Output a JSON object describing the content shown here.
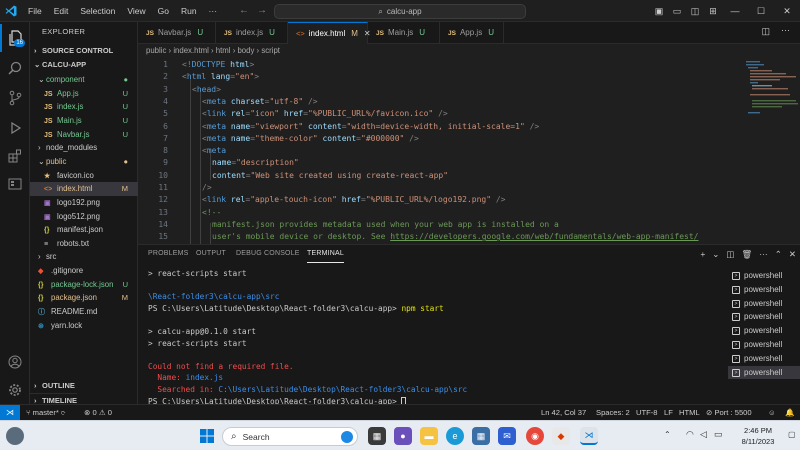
{
  "titlebar": {
    "menu": [
      "File",
      "Edit",
      "Selection",
      "View",
      "Go",
      "Run",
      "···"
    ],
    "search": "calcu-app"
  },
  "activity": {
    "badge": "16"
  },
  "sidebar": {
    "header": "EXPLORER",
    "source_control": "SOURCE CONTROL",
    "project": "CALCU-APP",
    "items": [
      {
        "label": "component",
        "kind": "folder-open",
        "depth": 1,
        "status": "●",
        "status_color": "#73c991"
      },
      {
        "label": "App.js",
        "kind": "js",
        "depth": 2,
        "status": "U",
        "status_color": "#73c991"
      },
      {
        "label": "index.js",
        "kind": "js",
        "depth": 2,
        "status": "U",
        "status_color": "#73c991"
      },
      {
        "label": "Main.js",
        "kind": "js",
        "depth": 2,
        "status": "U",
        "status_color": "#73c991"
      },
      {
        "label": "Navbar.js",
        "kind": "js",
        "depth": 2,
        "status": "U",
        "status_color": "#73c991"
      },
      {
        "label": "node_modules",
        "kind": "folder",
        "depth": 1,
        "status": "",
        "status_color": "#cccccc"
      },
      {
        "label": "public",
        "kind": "folder-open",
        "depth": 1,
        "status": "●",
        "status_color": "#e2c08d"
      },
      {
        "label": "favicon.ico",
        "kind": "star",
        "depth": 2,
        "status": "",
        "status_color": "#cccccc"
      },
      {
        "label": "index.html",
        "kind": "html",
        "depth": 2,
        "status": "M",
        "status_color": "#e2c08d",
        "selected": true
      },
      {
        "label": "logo192.png",
        "kind": "img",
        "depth": 2,
        "status": "",
        "status_color": "#cccccc"
      },
      {
        "label": "logo512.png",
        "kind": "img",
        "depth": 2,
        "status": "",
        "status_color": "#cccccc"
      },
      {
        "label": "manifest.json",
        "kind": "json",
        "depth": 2,
        "status": "",
        "status_color": "#cccccc"
      },
      {
        "label": "robots.txt",
        "kind": "txt",
        "depth": 2,
        "status": "",
        "status_color": "#cccccc"
      },
      {
        "label": "src",
        "kind": "folder",
        "depth": 1,
        "status": "",
        "status_color": "#cccccc"
      },
      {
        "label": ".gitignore",
        "kind": "git",
        "depth": 1,
        "status": "",
        "status_color": "#cccccc"
      },
      {
        "label": "package-lock.json",
        "kind": "json",
        "depth": 1,
        "status": "U",
        "status_color": "#73c991"
      },
      {
        "label": "package.json",
        "kind": "json",
        "depth": 1,
        "status": "M",
        "status_color": "#e2c08d"
      },
      {
        "label": "README.md",
        "kind": "info",
        "depth": 1,
        "status": "",
        "status_color": "#cccccc"
      },
      {
        "label": "yarn.lock",
        "kind": "yarn",
        "depth": 1,
        "status": "",
        "status_color": "#cccccc"
      }
    ],
    "outline": "OUTLINE",
    "timeline": "TIMELINE"
  },
  "tabs": [
    {
      "label": "Navbar.js",
      "kind": "js",
      "status": "U"
    },
    {
      "label": "index.js",
      "kind": "js",
      "status": "U"
    },
    {
      "label": "index.html",
      "kind": "html",
      "status": "M",
      "active": true
    },
    {
      "label": "Main.js",
      "kind": "js",
      "status": "U"
    },
    {
      "label": "App.js",
      "kind": "js",
      "status": "U"
    }
  ],
  "breadcrumb": [
    "public",
    "index.html",
    "html",
    "body",
    "script"
  ],
  "editor": {
    "lines": [
      {
        "n": "1",
        "tokens": [
          [
            "pn",
            "<!"
          ],
          [
            "tg",
            "DOCTYPE"
          ],
          [
            "at",
            " html"
          ],
          [
            "pn",
            ">"
          ]
        ],
        "indent": 0
      },
      {
        "n": "2",
        "tokens": [
          [
            "pn",
            "<"
          ],
          [
            "tg",
            "html"
          ],
          [
            "at",
            " lang"
          ],
          [
            "pn",
            "="
          ],
          [
            "sv",
            "\"en\""
          ],
          [
            "pn",
            ">"
          ]
        ],
        "indent": 0
      },
      {
        "n": "3",
        "tokens": [
          [
            "pn",
            "<"
          ],
          [
            "tg",
            "head"
          ],
          [
            "pn",
            ">"
          ]
        ],
        "indent": 1
      },
      {
        "n": "4",
        "tokens": [
          [
            "pn",
            "<"
          ],
          [
            "tg",
            "meta"
          ],
          [
            "at",
            " charset"
          ],
          [
            "pn",
            "="
          ],
          [
            "sv",
            "\"utf-8\""
          ],
          [
            "pn",
            " />"
          ]
        ],
        "indent": 2
      },
      {
        "n": "5",
        "tokens": [
          [
            "pn",
            "<"
          ],
          [
            "tg",
            "link"
          ],
          [
            "at",
            " rel"
          ],
          [
            "pn",
            "="
          ],
          [
            "sv",
            "\"icon\""
          ],
          [
            "at",
            " href"
          ],
          [
            "pn",
            "="
          ],
          [
            "sv",
            "\"%PUBLIC_URL%/favicon.ico\""
          ],
          [
            "pn",
            " />"
          ]
        ],
        "indent": 2
      },
      {
        "n": "6",
        "tokens": [
          [
            "pn",
            "<"
          ],
          [
            "tg",
            "meta"
          ],
          [
            "at",
            " name"
          ],
          [
            "pn",
            "="
          ],
          [
            "sv",
            "\"viewport\""
          ],
          [
            "at",
            " content"
          ],
          [
            "pn",
            "="
          ],
          [
            "sv",
            "\"width=device-width, initial-scale=1\""
          ],
          [
            "pn",
            " />"
          ]
        ],
        "indent": 2
      },
      {
        "n": "7",
        "tokens": [
          [
            "pn",
            "<"
          ],
          [
            "tg",
            "meta"
          ],
          [
            "at",
            " name"
          ],
          [
            "pn",
            "="
          ],
          [
            "sv",
            "\"theme-color\""
          ],
          [
            "at",
            " content"
          ],
          [
            "pn",
            "="
          ],
          [
            "sv",
            "\"#000000\""
          ],
          [
            "pn",
            " />"
          ]
        ],
        "indent": 2
      },
      {
        "n": "8",
        "tokens": [
          [
            "pn",
            "<"
          ],
          [
            "tg",
            "meta"
          ]
        ],
        "indent": 2
      },
      {
        "n": "9",
        "tokens": [
          [
            "at",
            "name"
          ],
          [
            "pn",
            "="
          ],
          [
            "sv",
            "\"description\""
          ]
        ],
        "indent": 3
      },
      {
        "n": "10",
        "tokens": [
          [
            "at",
            "content"
          ],
          [
            "pn",
            "="
          ],
          [
            "sv",
            "\"Web site created using create-react-app\""
          ]
        ],
        "indent": 3
      },
      {
        "n": "11",
        "tokens": [
          [
            "pn",
            "/>"
          ]
        ],
        "indent": 2
      },
      {
        "n": "12",
        "tokens": [
          [
            "pn",
            "<"
          ],
          [
            "tg",
            "link"
          ],
          [
            "at",
            " rel"
          ],
          [
            "pn",
            "="
          ],
          [
            "sv",
            "\"apple-touch-icon\""
          ],
          [
            "at",
            " href"
          ],
          [
            "pn",
            "="
          ],
          [
            "sv",
            "\"%PUBLIC_URL%/logo192.png\""
          ],
          [
            "pn",
            " />"
          ]
        ],
        "indent": 2
      },
      {
        "n": "13",
        "tokens": [
          [
            "cm",
            "<!--"
          ]
        ],
        "indent": 2
      },
      {
        "n": "14",
        "tokens": [
          [
            "cm",
            "manifest.json provides metadata used when your web app is installed on a"
          ]
        ],
        "indent": 3
      },
      {
        "n": "15",
        "tokens": [
          [
            "cm",
            "user's mobile device or desktop. See "
          ],
          [
            "lk",
            "https://developers.google.com/web/fundamentals/web-app-manifest/"
          ]
        ],
        "indent": 3
      }
    ]
  },
  "panel": {
    "tabs": [
      "PROBLEMS",
      "OUTPUT",
      "DEBUG CONSOLE",
      "TERMINAL"
    ],
    "active_tab": "TERMINAL",
    "terminal_lines": [
      {
        "cls": "",
        "text": "> react-scripts start"
      },
      {
        "cls": "",
        "text": ""
      },
      {
        "cls": "blue",
        "text": "\\React-folder3\\calcu-app\\src"
      },
      {
        "cls": "",
        "text": "PS C:\\Users\\Latitude\\Desktop\\React-folder3\\calcu-app> ",
        "cmd": "npm start"
      },
      {
        "cls": "",
        "text": ""
      },
      {
        "cls": "",
        "text": "> calcu-app@0.1.0 start"
      },
      {
        "cls": "",
        "text": "> react-scripts start"
      },
      {
        "cls": "",
        "text": ""
      },
      {
        "cls": "red",
        "text": "Could not find a required file."
      },
      {
        "cls": "red",
        "text": "  Name: ",
        "value": "index.js"
      },
      {
        "cls": "red",
        "text": "  Searched in: ",
        "value": "C:\\Users\\Latitude\\Desktop\\React-folder3\\calcu-app\\src"
      },
      {
        "cls": "",
        "text": "PS C:\\Users\\Latitude\\Desktop\\React-folder3\\calcu-app> ",
        "cursor": true
      }
    ],
    "terminals": [
      "powershell",
      "powershell",
      "powershell",
      "powershell",
      "powershell",
      "powershell",
      "powershell",
      "powershell"
    ],
    "selected_terminal": 7
  },
  "status": {
    "branch": "master*",
    "errors": "0",
    "warnings": "0",
    "position": "Ln 42, Col 37",
    "spaces": "Spaces: 2",
    "encoding": "UTF-8",
    "eol": "LF",
    "language": "HTML",
    "port": "Port : 5500"
  },
  "taskbar": {
    "search": "Search",
    "time": "2:46 PM",
    "date": "8/11/2023"
  },
  "colors": {
    "accent": "#0078d4",
    "untracked": "#73c991",
    "modified": "#e2c08d",
    "error": "#f14c4c"
  }
}
